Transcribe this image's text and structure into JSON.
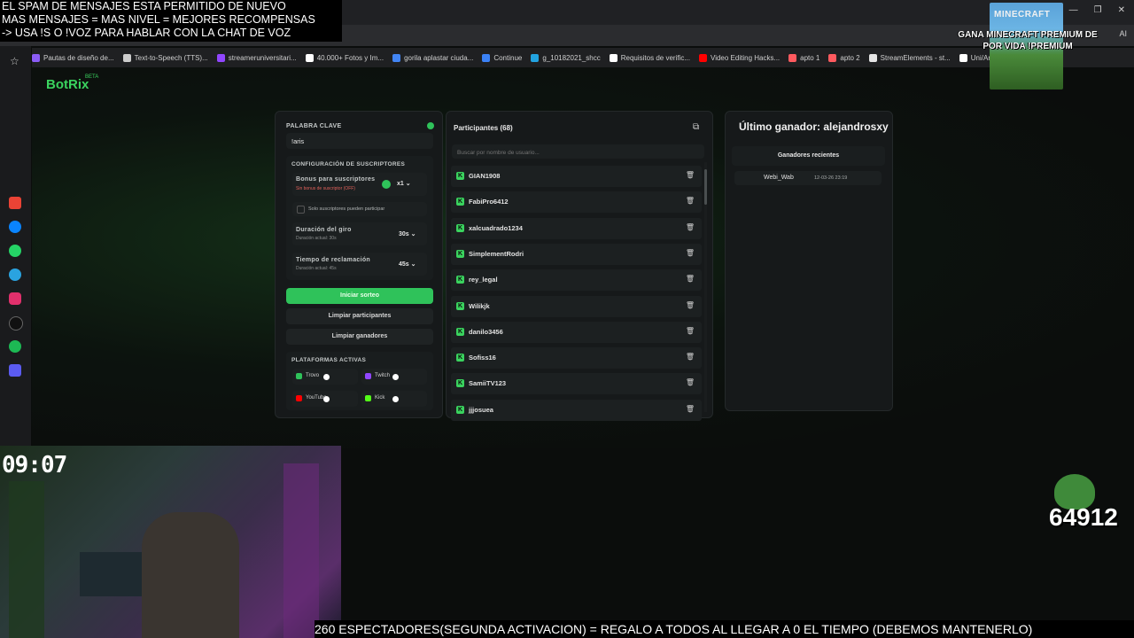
{
  "overlay": {
    "line1": "EL SPAM DE MENSAJES ESTA PERMITIDO DE NUEVO",
    "line2": "MAS MENSAJES = MAS NIVEL = MEJORES RECOMPENSAS",
    "line3": "-> USA !S O !VOZ PARA HABLAR CON LA CHAT DE VOZ",
    "clock": "09:07",
    "counter": "64912",
    "ticker": "260 ESPECTADORES(SEGUNDA ACTIVACION) = REGALO A TODOS AL LLEGAR A 0 EL TIEMPO (DEBEMOS MANTENERLO)",
    "minecraft_logo": "MINECRAFT",
    "minecraft_text": "GANA MINECRAFT PREMIUM DE POR VIDA !PREMIUM"
  },
  "browser": {
    "ai_label": "AI",
    "bookmarks": [
      {
        "label": "Pautas de diseño de...",
        "color": "#8b5cf6"
      },
      {
        "label": "Text-to-Speech (TTS)...",
        "color": "#cccccc"
      },
      {
        "label": "streameruniversitari...",
        "color": "#9146ff"
      },
      {
        "label": "40.000+ Fotos y Im...",
        "color": "#ffffff"
      },
      {
        "label": "gorila aplastar ciuda...",
        "color": "#4285f4"
      },
      {
        "label": "Continue",
        "color": "#3b82f6"
      },
      {
        "label": "g_10182021_shcc",
        "color": "#22a3e0"
      },
      {
        "label": "Requisitos de verific...",
        "color": "#ffffff"
      },
      {
        "label": "Video Editing Hacks...",
        "color": "#ff0000"
      },
      {
        "label": "apto 1",
        "color": "#ff5a5f"
      },
      {
        "label": "apto 2",
        "color": "#ff5a5f"
      },
      {
        "label": "StreamElements - st...",
        "color": "#e5e5e5"
      },
      {
        "label": "Uni/Aris",
        "color": "#ffffff"
      }
    ]
  },
  "app": {
    "brand": "BotRix",
    "beta": "BETA",
    "keyword_label": "PALABRA CLAVE",
    "keyword_value": "!aris",
    "subs_config_label": "CONFIGURACIÓN DE SUSCRIPTORES",
    "bonus_label": "Bonus para suscriptores",
    "bonus_hint": "Sin bonus de suscriptor (OFF)",
    "bonus_value": "x1",
    "subs_only_label": "Solo suscriptores pueden participar",
    "spin_label": "Duración del giro",
    "spin_hint": "Duración actual: 30s",
    "spin_value": "30s",
    "claim_label": "Tiempo de reclamación",
    "claim_hint": "Duración actual: 45s",
    "claim_value": "45s",
    "start_button": "Iniciar sorteo",
    "clear_participants_button": "Limpiar participantes",
    "clear_winners_button": "Limpiar ganadores",
    "platforms_label": "PLATAFORMAS ACTIVAS",
    "platforms": [
      {
        "name": "Trovo",
        "color": "#2fc25a"
      },
      {
        "name": "Twitch",
        "color": "#9146ff"
      },
      {
        "name": "YouTube",
        "color": "#ff0000"
      },
      {
        "name": "Kick",
        "color": "#53fc18"
      }
    ],
    "participants_title": "Participantes (68)",
    "search_placeholder": "Buscar por nombre de usuario...",
    "participants": [
      "GIAN1908",
      "FabiPro6412",
      "xalcuadrado1234",
      "SimplementRodri",
      "rey_legal",
      "Wilikjk",
      "danilo3456",
      "Sofiss16",
      "SamiiTV123",
      "jjjosuea"
    ],
    "last_winner": "Último ganador: alejandrosxy",
    "recent_winners_label": "Ganadores recientes",
    "recent_winners": [
      {
        "name": "Webi_Wab",
        "date": "12-03-26 23:19"
      }
    ]
  }
}
